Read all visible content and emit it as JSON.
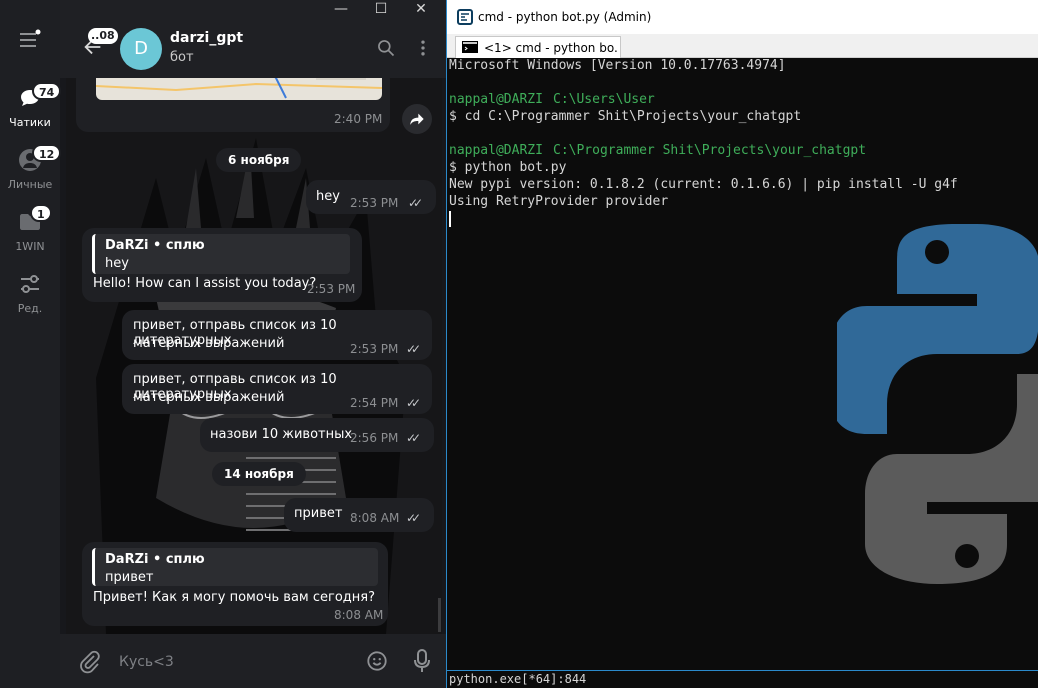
{
  "telegram": {
    "sidebar": {
      "items": [
        {
          "label": "Чатики",
          "badge": "74",
          "active": true
        },
        {
          "label": "Личные",
          "badge": "12"
        },
        {
          "label": "1WIN",
          "badge": "1"
        },
        {
          "label": "Ред."
        }
      ]
    },
    "header": {
      "back_badge": "..08",
      "avatar_letter": "D",
      "chat_name": "darzi_gpt",
      "chat_status": "бот"
    },
    "messages": {
      "map_time": "2:40 PM",
      "date1": "6 ноября",
      "m1": {
        "text": "hey",
        "time": "2:53 PM"
      },
      "m2": {
        "reply_author": "DaRZi • сплю",
        "reply_text": "hey",
        "text": "Hello! How can I assist you today?",
        "time": "2:53 PM"
      },
      "m3": {
        "line1": "привет, отправь список из 10 литературных",
        "line2": "матерных выражений",
        "time": "2:53 PM"
      },
      "m4": {
        "line1": "привет, отправь список из 10 литературных",
        "line2": "матерных выражений",
        "time": "2:54 PM"
      },
      "m5": {
        "text": "назови 10 животных",
        "time": "2:56 PM"
      },
      "date2": "14 ноября",
      "m6": {
        "text": "привет",
        "time": "8:08 AM"
      },
      "m7": {
        "reply_author": "DaRZi • сплю",
        "reply_text": "привет",
        "text": "Привет! Как я могу помочь вам сегодня?",
        "time": "8:08 AM"
      }
    },
    "composer": {
      "value": "Кусь<3"
    }
  },
  "cmd": {
    "title": "cmd - python  bot.py (Admin)",
    "tab_label": "<1> cmd - python  bo...",
    "lines": {
      "l1": "Microsoft Windows [Version 10.0.17763.4974]",
      "l2_user": "nappal@DARZI",
      "l2_path": "C:\\Users\\User",
      "l3": "$ cd C:\\Programmer Shit\\Projects\\your_chatgpt",
      "l4_user": "nappal@DARZI",
      "l4_path": "C:\\Programmer Shit\\Projects\\your_chatgpt",
      "l5": "$ python bot.py",
      "l6": "New pypi version: 0.1.8.2 (current: 0.1.6.6) | pip install -U g4f",
      "l7": "Using RetryProvider provider"
    },
    "status_bar": "python.exe[*64]:844"
  },
  "colors": {
    "terminal_green": "#3fae5a",
    "telegram_avatar": "#6bc7d6",
    "python_blue": "#306998",
    "python_gray": "#5b5b5b"
  }
}
